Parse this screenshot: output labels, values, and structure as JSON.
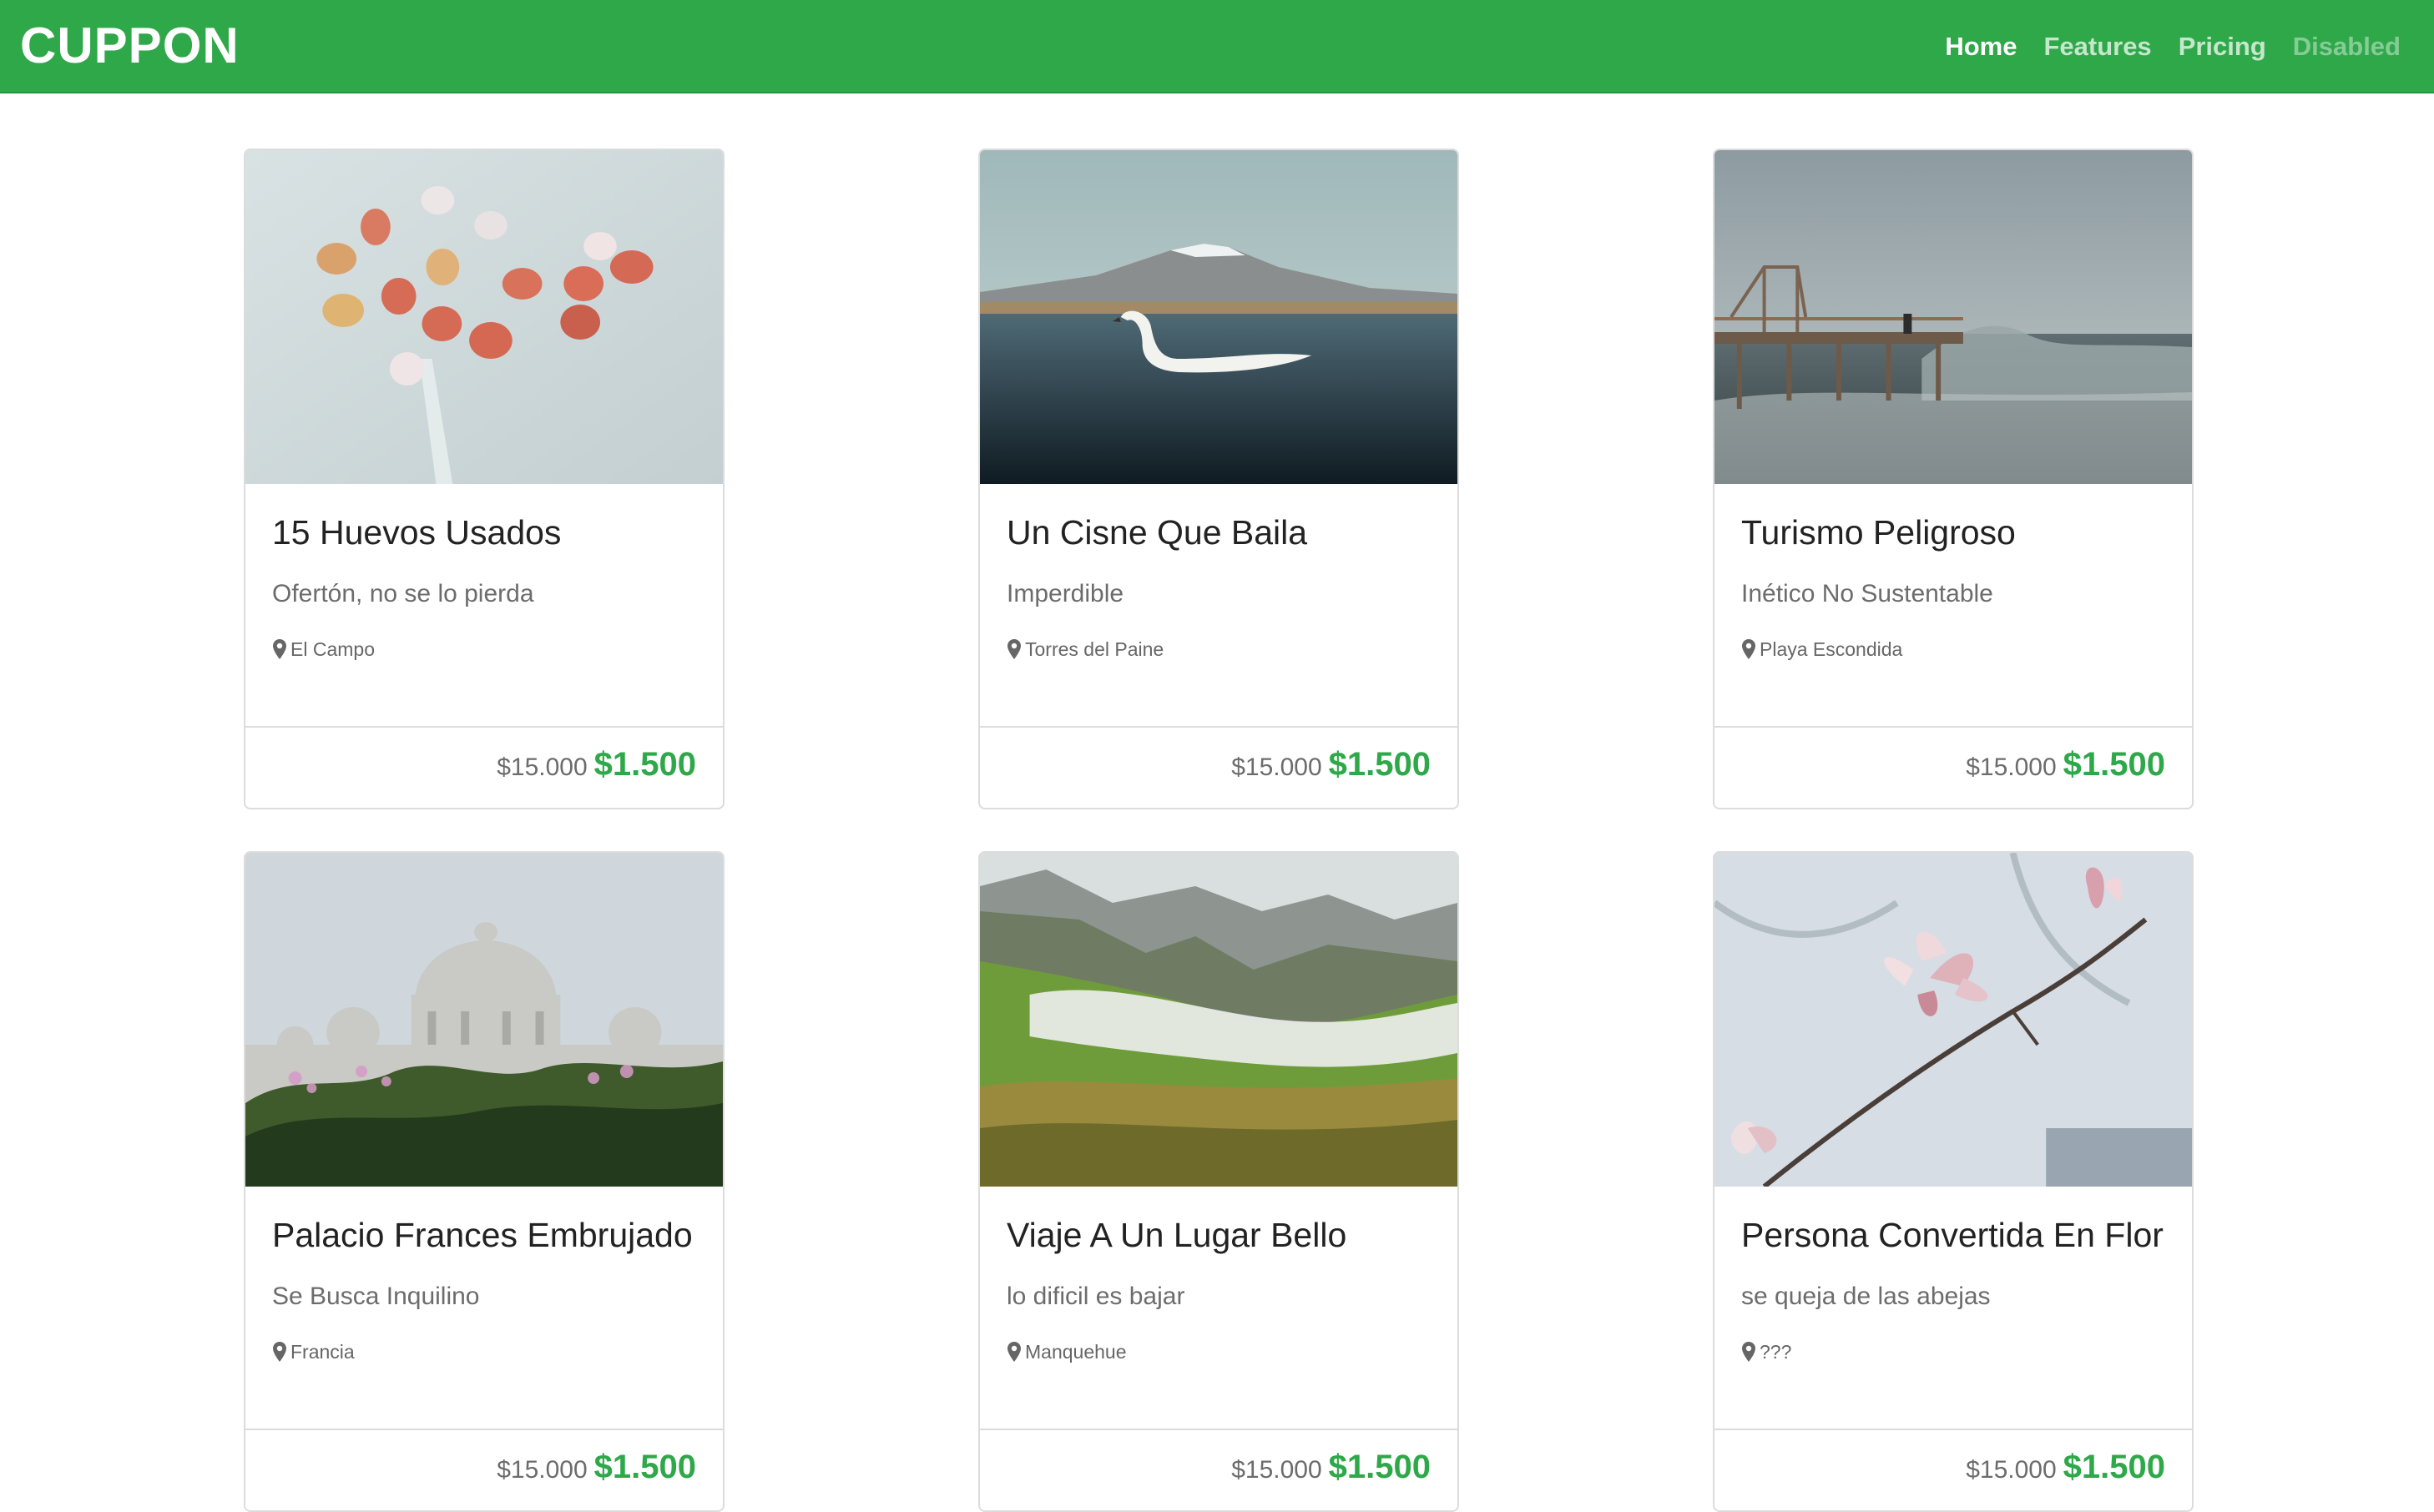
{
  "navbar": {
    "brand": "CUPPON",
    "links": [
      {
        "label": "Home"
      },
      {
        "label": "Features"
      },
      {
        "label": "Pricing"
      },
      {
        "label": "Disabled"
      }
    ]
  },
  "colors": {
    "brand_green": "#2fa84a",
    "text_dark": "#222222",
    "text_muted": "#6c6c6c"
  },
  "cards": [
    {
      "title": "15 Huevos Usados",
      "subtitle": "Ofertón, no se lo pierda",
      "location": "El Campo",
      "old_price": "$15.000",
      "price": "$1.500",
      "image": "speckled-eggs-photo"
    },
    {
      "title": "Un Cisne Que Baila",
      "subtitle": "Imperdible",
      "location": "Torres del Paine",
      "old_price": "$15.000",
      "price": "$1.500",
      "image": "swan-lake-photo"
    },
    {
      "title": "Turismo Peligroso",
      "subtitle": "Inético No Sustentable",
      "location": "Playa Escondida",
      "old_price": "$15.000",
      "price": "$1.500",
      "image": "pier-waves-photo"
    },
    {
      "title": "Palacio Frances Embrujado",
      "subtitle": "Se Busca Inquilino",
      "location": "Francia",
      "old_price": "$15.000",
      "price": "$1.500",
      "image": "basilica-photo"
    },
    {
      "title": "Viaje A Un Lugar Bello",
      "subtitle": "lo dificil es bajar",
      "location": "Manquehue",
      "old_price": "$15.000",
      "price": "$1.500",
      "image": "mountain-valley-photo"
    },
    {
      "title": "Persona Convertida En Flor",
      "subtitle": "se queja de las abejas",
      "location": "???",
      "old_price": "$15.000",
      "price": "$1.500",
      "image": "magnolia-flower-photo"
    }
  ]
}
